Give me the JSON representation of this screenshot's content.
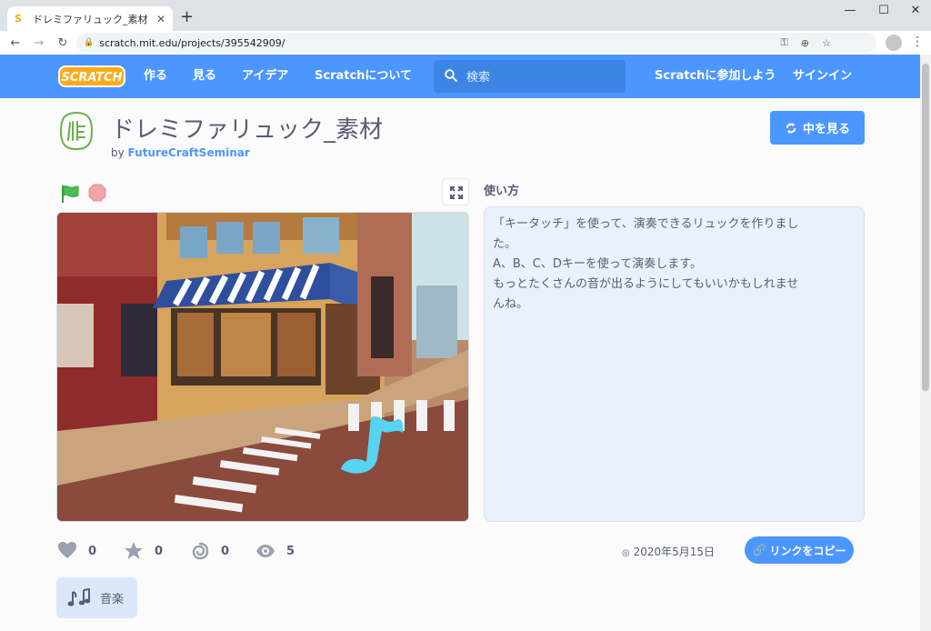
{
  "browser": {
    "tab_title": "ドレミファリュック_素材 on Scratch",
    "url": "scratch.mit.edu/projects/395542909/"
  },
  "navbar": {
    "logo": "SCRATCH",
    "create": "作る",
    "explore": "見る",
    "ideas": "アイデア",
    "about": "Scratchについて",
    "search_placeholder": "検索",
    "join": "Scratchに参加しよう",
    "signin": "サインイン"
  },
  "project": {
    "title": "ドレミファリュック_素材",
    "by": "by",
    "author": "FutureCraftSeminar",
    "see_inside": "中を見る"
  },
  "instructions": {
    "heading": "使い方",
    "lines": [
      "「キータッチ」を使って、演奏できるリュックを作りまし",
      "た。",
      "A、B、C、Dキーを使って演奏します。",
      "もっとたくさんの音が出るようにしてもいいかもしれませ",
      "んね。"
    ]
  },
  "stats": {
    "loves": "0",
    "favorites": "0",
    "remixes": "0",
    "views": "5"
  },
  "share_date": "2020年5月15日",
  "copy_link": "リンクをコピー",
  "tag": "音楽",
  "colors": {
    "scratch_blue": "#4c97ff",
    "instructions_bg": "#e9f1fc",
    "text": "#575e75"
  }
}
